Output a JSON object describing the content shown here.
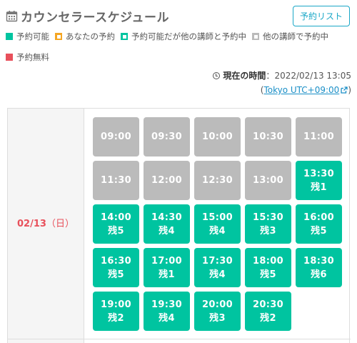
{
  "header": {
    "title": "カウンセラースケジュール",
    "list_button": "予約リスト"
  },
  "legend": [
    {
      "label": "予約可能",
      "color": "#00c4a0",
      "inner": false
    },
    {
      "label": "あなたの予約",
      "color": "#f5a623",
      "inner": true
    },
    {
      "label": "予約可能だが他の講師と予約中",
      "color": "#00c4a0",
      "inner": true
    },
    {
      "label": "他の講師で予約中",
      "color": "#bbbbbb",
      "inner": true
    },
    {
      "label": "予約無料",
      "color": "#e8505b",
      "inner": false
    }
  ],
  "current_time": {
    "label": "現在の時間",
    "sep": "：",
    "value": "2022/02/13 13:05",
    "tz_open": "(",
    "tz_link": "Tokyo UTC+09:00",
    "tz_close": ")"
  },
  "schedule": {
    "date": "02/13",
    "dow": "（日）",
    "slots": [
      {
        "time": "09:00",
        "status": "unavailable",
        "remaining": ""
      },
      {
        "time": "09:30",
        "status": "unavailable",
        "remaining": ""
      },
      {
        "time": "10:00",
        "status": "unavailable",
        "remaining": ""
      },
      {
        "time": "10:30",
        "status": "unavailable",
        "remaining": ""
      },
      {
        "time": "11:00",
        "status": "unavailable",
        "remaining": ""
      },
      {
        "time": "11:30",
        "status": "unavailable",
        "remaining": ""
      },
      {
        "time": "12:00",
        "status": "unavailable",
        "remaining": ""
      },
      {
        "time": "12:30",
        "status": "unavailable",
        "remaining": ""
      },
      {
        "time": "13:00",
        "status": "unavailable",
        "remaining": ""
      },
      {
        "time": "13:30",
        "status": "available",
        "remaining": "残1"
      },
      {
        "time": "14:00",
        "status": "available",
        "remaining": "残5"
      },
      {
        "time": "14:30",
        "status": "available",
        "remaining": "残4"
      },
      {
        "time": "15:00",
        "status": "available",
        "remaining": "残4"
      },
      {
        "time": "15:30",
        "status": "available",
        "remaining": "残3"
      },
      {
        "time": "16:00",
        "status": "available",
        "remaining": "残5"
      },
      {
        "time": "16:30",
        "status": "available",
        "remaining": "残5"
      },
      {
        "time": "17:00",
        "status": "available",
        "remaining": "残1"
      },
      {
        "time": "17:30",
        "status": "available",
        "remaining": "残4"
      },
      {
        "time": "18:00",
        "status": "available",
        "remaining": "残5"
      },
      {
        "time": "18:30",
        "status": "available",
        "remaining": "残6"
      },
      {
        "time": "19:00",
        "status": "available",
        "remaining": "残2"
      },
      {
        "time": "19:30",
        "status": "available",
        "remaining": "残4"
      },
      {
        "time": "20:00",
        "status": "available",
        "remaining": "残3"
      },
      {
        "time": "20:30",
        "status": "available",
        "remaining": "残2"
      }
    ]
  }
}
